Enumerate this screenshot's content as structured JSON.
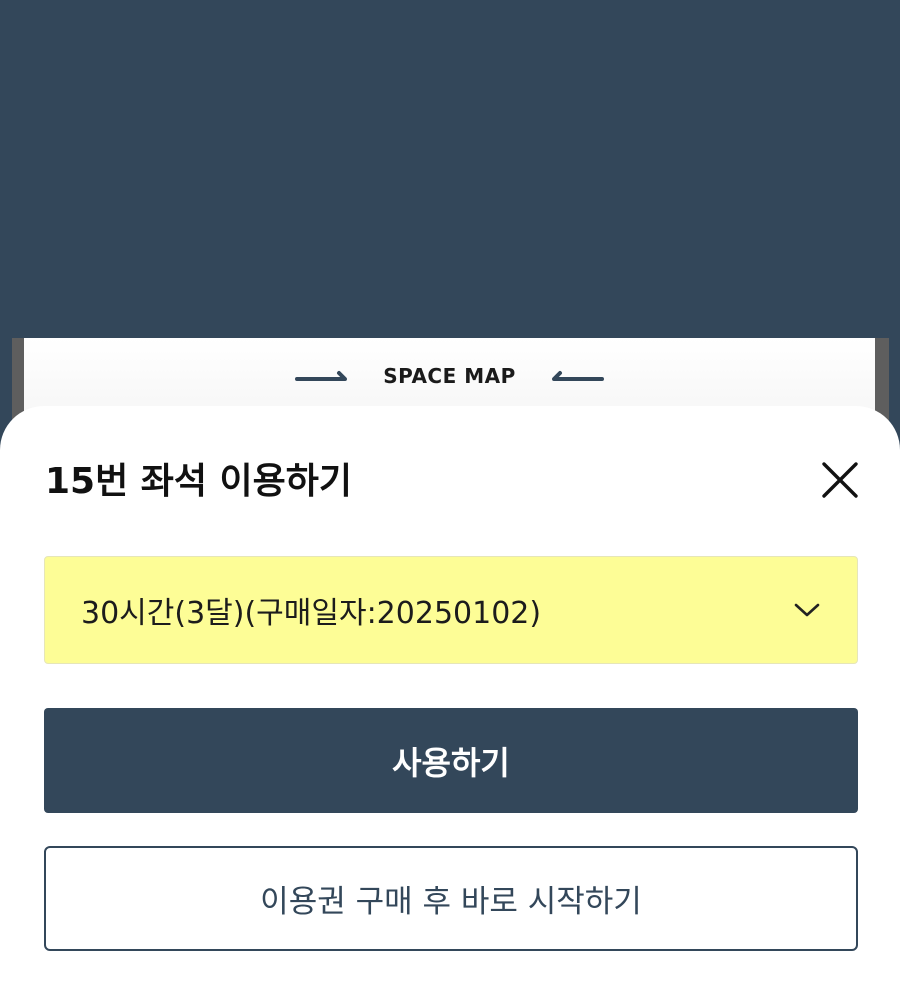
{
  "background_page": {
    "map_title": "SPACE MAP",
    "left_arrow_icon": "long-arrow-right-icon",
    "right_arrow_icon": "long-arrow-left-icon"
  },
  "sheet": {
    "title": "15번 좌석 이용하기",
    "close_icon": "close-icon",
    "ticket_select": {
      "selected_value": "30시간(3달)(구매일자:20250102)",
      "icon": "chevron-down-icon"
    },
    "use_button_label": "사용하기",
    "buy_and_start_button_label": "이용권 구매 후 바로 시작하기"
  },
  "colors": {
    "brand_navy": "#33475a",
    "select_highlight": "#fdfd96",
    "surface": "#ffffff"
  }
}
